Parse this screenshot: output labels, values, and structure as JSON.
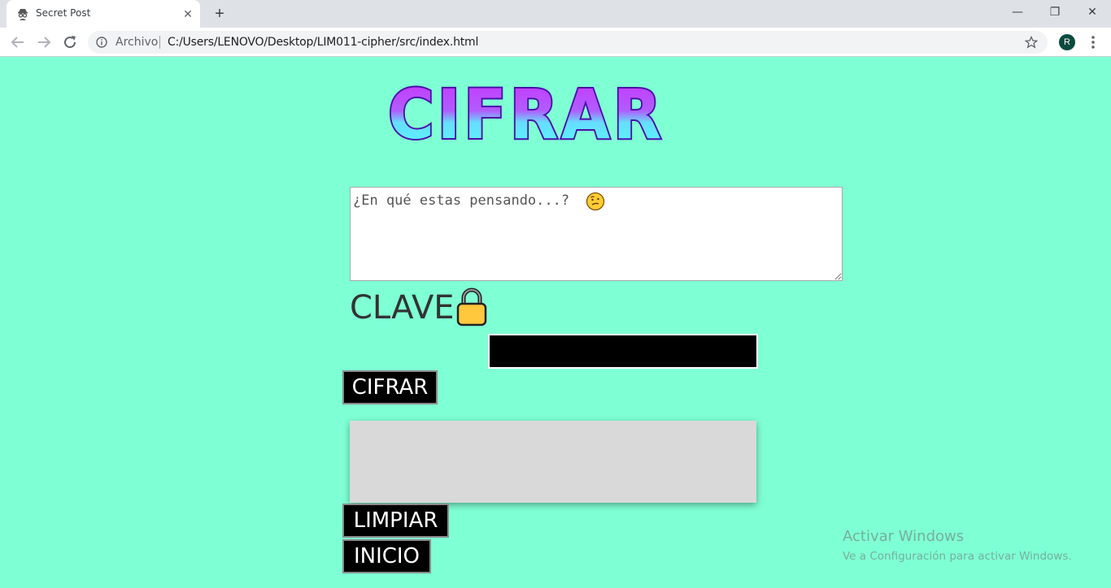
{
  "browser": {
    "tab_title": "Secret Post",
    "tab_close": "✕",
    "new_tab": "+",
    "window_controls": {
      "minimize": "—",
      "restore": "❐",
      "close": "✕"
    },
    "origin_label": "Archivo",
    "url": "C:/Users/LENOVO/Desktop/LIM011-cipher/src/index.html",
    "profile_initial": "R"
  },
  "page": {
    "logo_text": "CIFRAR",
    "message_placeholder": "¿En qué estas pensando...?",
    "message_value": "",
    "key_label": "CLAVE",
    "key_value": "",
    "encrypt_button": "CIFRAR",
    "output_text": "",
    "clear_button": "LIMPIAR",
    "home_button": "INICIO"
  },
  "watermark": {
    "title": "Activar Windows",
    "subtitle": "Ve a Configuración para activar Windows."
  },
  "colors": {
    "background": "#7fffd4",
    "logo_gradient_top": "#cc33ff",
    "logo_gradient_bottom": "#55ffff",
    "logo_outline": "#4a0fa8"
  }
}
